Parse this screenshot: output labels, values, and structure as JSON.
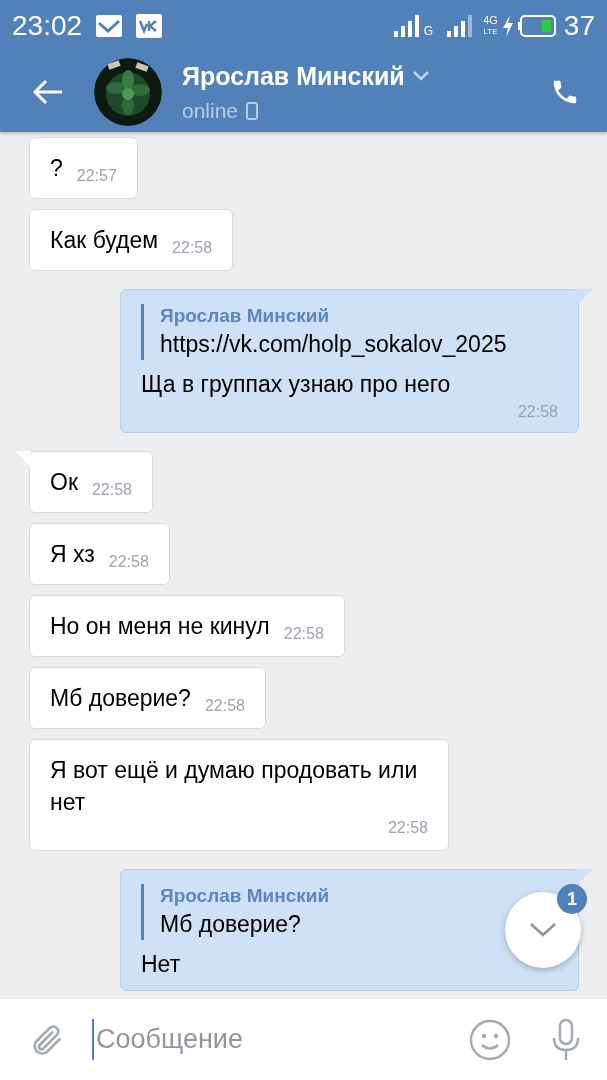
{
  "status_bar": {
    "time": "23:02",
    "network_1": "G",
    "network_2_top": "4G",
    "network_2_bottom": "LTE",
    "battery": "37"
  },
  "header": {
    "name": "Ярослав Минский",
    "status": "online"
  },
  "messages": [
    {
      "kind": "incoming",
      "tail": false,
      "text": "?",
      "time": "22:57"
    },
    {
      "kind": "incoming",
      "tail": false,
      "text": "Как будем",
      "time": "22:58"
    },
    {
      "kind": "outgoing",
      "tail": true,
      "quote": {
        "author": "Ярослав Минский",
        "text": "https://vk.com/holp_sokalov_2025"
      },
      "text": "Ща в группах узнаю про него",
      "time": "22:58"
    },
    {
      "kind": "incoming",
      "tail": true,
      "text": "Ок",
      "time": "22:58"
    },
    {
      "kind": "incoming",
      "tail": false,
      "text": "Я хз",
      "time": "22:58"
    },
    {
      "kind": "incoming",
      "tail": false,
      "text": "Но он меня не кинул",
      "time": "22:58"
    },
    {
      "kind": "incoming",
      "tail": false,
      "text": "Мб доверие?",
      "time": "22:58"
    },
    {
      "kind": "incoming",
      "tail": false,
      "text": "Я вот ещё и думаю продовать или нет",
      "time": "22:58"
    },
    {
      "kind": "outgoing",
      "tail": true,
      "quote": {
        "author": "Ярослав Минский",
        "text": "Мб доверие?"
      },
      "text": "Нет"
    }
  ],
  "scroll_button": {
    "badge": "1"
  },
  "composer": {
    "placeholder": "Сообщение"
  }
}
